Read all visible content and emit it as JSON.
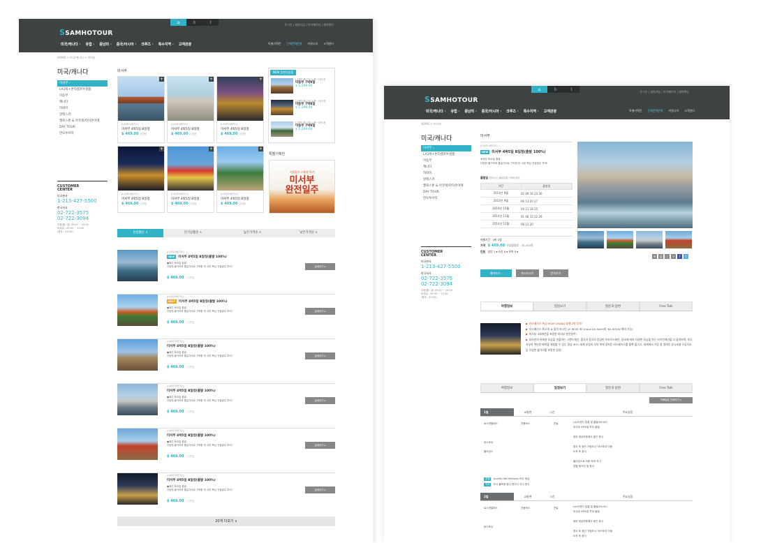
{
  "header": {
    "brand": "SAMHOTOUR",
    "util": "로그인  |  회원가입  |  마이페이지  |  예약확인",
    "gnb": [
      "미국/캐나다",
      "유럽",
      "중남미",
      "중국/아시아",
      "크루즈",
      "특수지역",
      "고객관광"
    ],
    "rnav": [
      "특별기획전",
      "단체견적문의",
      "커뮤니티",
      "고객센터"
    ],
    "rnav_active": 1
  },
  "p1": {
    "crumb": "HOME > 미국/캐나다 > 미서부",
    "title": "미국/캐나다",
    "side": [
      "미서부",
      "LA1박+온리캠프투성품",
      "미동부",
      "캐나다",
      "하와이",
      "알래스카",
      "옐로스톤 & 아웃렛/라이온이에",
      "DAY TOUR",
      "한모투어지"
    ],
    "contact": {
      "title": "CUSTOMER\nCENTER",
      "hq": "미국본사",
      "hq_phone": "1-213-427-5500",
      "kr": "한국지사",
      "kr_phone1": "02-722-3575",
      "kr_phone2": "02-722-3094",
      "hours1": "주중(월~금) 09:00 ~ 16:00",
      "hours2": "토요일 : 09:00 ~ 13:00",
      "hours3": "(휴무 : 13:00)"
    },
    "section": "미서부",
    "cards": [
      {
        "sub": "[LA/라스베가스]",
        "name": "미서부 4박5일 B일정",
        "price": "$ 469.00",
        "unit": "/1인당"
      },
      {
        "sub": "[LA/라스베가스]",
        "name": "미서부 4박5일 B일정",
        "price": "$ 469.00",
        "unit": "/1인당"
      },
      {
        "sub": "[LA/라스베가스]",
        "name": "미서부 4박5일 B일정",
        "price": "$ 469.00",
        "unit": "/1인당"
      },
      {
        "sub": "[LA/라스베가스]",
        "name": "미서부 4박5일 B일정",
        "price": "$ 469.00",
        "unit": "/1인당"
      },
      {
        "sub": "[LA/라스베가스]",
        "name": "미서부 4박5일 B일정",
        "price": "$ 469.00",
        "unit": "/1인당"
      },
      {
        "sub": "[LA/라스베가스]",
        "name": "미서부 4박5일 B일정",
        "price": "$ 469.00",
        "unit": "/1인당"
      }
    ],
    "new_badge": "NEW 추천신상품",
    "new_items": [
      {
        "sub": "[그랜드캐니언] 뉴욕~1만1천",
        "name": "미동부 7박8일",
        "price": "$ 1,299.00"
      },
      {
        "sub": "[그랜드캐니언] 뉴욕~1만1천",
        "name": "미동부 7박8일",
        "price": "$ 1,299.00"
      },
      {
        "sub": "[그랜드캐니언] 뉴욕~1만1천",
        "name": "미동부 7박8일",
        "price": "$ 1,299.00"
      }
    ],
    "promo_title": "특별기획전",
    "promo_small": "가을맞이 스페셜 특가",
    "promo_big": "미서부\n완전일주",
    "sorts": [
      "신상품순",
      "인기상품순",
      "높은가격순",
      "낮은가격순"
    ],
    "rows": [
      {
        "sub": "[LA/라스베가스]",
        "badge": "NEW",
        "badge_color": "#31b2c7",
        "title": "미서부 4박5일 B일정(출발 100%)",
        "d1": "●매주 토요일 출발",
        "d2": "다양한 볼거리와 즐길거리로 가득한 미 서부 핵심 관광일주 투어!",
        "price": "$ 469.00",
        "unit": "/1인당",
        "btn": "상세보기 ▸"
      },
      {
        "sub": "[LA/라스베가스]",
        "badge": "BEST",
        "badge_color": "#f0a030",
        "title": "미서부 4박5일 B일정(출발 100%)",
        "d1": "●매주 토요일 출발",
        "d2": "다양한 볼거리와 즐길거리로 가득한 미 서부 핵심 관광일주 투어!",
        "price": "$ 469.00",
        "unit": "/1인당",
        "btn": "상세보기 ▸"
      },
      {
        "sub": "[LA/라스베가스]",
        "badge": "",
        "badge_color": "",
        "title": "미서부 4박5일 B일정(출발 100%)",
        "d1": "●매주 토요일 출발",
        "d2": "다양한 볼거리와 즐길거리로 가득한 미 서부 핵심 관광일주 투어!",
        "price": "$ 469.00",
        "unit": "/1인당",
        "btn": "상세보기 ▸"
      },
      {
        "sub": "[LA/라스베가스]",
        "badge": "",
        "badge_color": "",
        "title": "미서부 4박5일 B일정(출발 100%)",
        "d1": "●매주 토요일 출발",
        "d2": "다양한 볼거리와 즐길거리로 가득한 미 서부 핵심 관광일주 투어!",
        "price": "$ 469.00",
        "unit": "/1인당",
        "btn": "상세보기 ▸"
      },
      {
        "sub": "[LA/라스베가스]",
        "badge": "",
        "badge_color": "",
        "title": "미서부 4박5일 B일정(출발 100%)",
        "d1": "●매주 토요일 출발",
        "d2": "다양한 볼거리와 즐길거리로 가득한 미 서부 핵심 관광일주 투어!",
        "price": "$ 469.00",
        "unit": "/1인당",
        "btn": "상세보기 ▸"
      },
      {
        "sub": "[LA/라스베가스]",
        "badge": "",
        "badge_color": "",
        "title": "미서부 4박5일 B일정(출발 100%)",
        "d1": "●매주 토요일 출발",
        "d2": "다양한 볼거리와 즐길거리로 가득한 미 서부 핵심 관광일주 투어!",
        "price": "$ 469.00",
        "unit": "/1인당",
        "btn": "상세보기 ▸"
      }
    ],
    "more": "20개 더보기 ∨"
  },
  "p2": {
    "crumb": "HOME > 미서부",
    "section": "미서부",
    "sub": "[LA/라스베가스]",
    "badge": "NEW",
    "title": "미서부 4박5일 B일정(출발 100%)",
    "d1": "★매주 토요일 출발",
    "d2": "다양한 볼거리와 즐길거리로 가득한 미 서부 핵심 관광일주 투어!",
    "dep_label": "출발일",
    "dep_hint": "원하시는 출발일을 선택하세요",
    "tab_head": [
      "기간",
      "출발일"
    ],
    "dates": [
      [
        "2014년 9월",
        "02  09  16  23  30"
      ],
      [
        "2014년 9월",
        "06  13  20  27"
      ],
      [
        "2014년 10월",
        "04  11  18  25"
      ],
      [
        "2014년 11월",
        "01  08  15  22  29"
      ],
      [
        "2014년 12월",
        "06  13  20"
      ]
    ],
    "period_label": "여행기간",
    "period": "4박 5일",
    "price_label": "가격",
    "price": "$ 469.00",
    "price_extra": "유류할증료 : 30,000원",
    "people_label": "인원",
    "people": "성인  1  ▾    소인  0  ▾    유아  0  ▾",
    "btn1": "예약하기 ›",
    "btn2": "위시리스트",
    "btn3": "문의하기",
    "tabs": [
      "여행정보",
      "일정보기",
      "질문과 답변",
      "Free Talk"
    ],
    "info": [
      {
        "t": "라스베가스 특급 MGM GRAND 호텔 2박 투숙!"
      },
      {
        "t": "라스베가스 최고의 쇼 중의 하나인 LE REVE 와 Cirque Du Soleil의 'KA SHOW 예약 가능!"
      },
      {
        "t": "미서부 3대캐년을 포함한 미서부 완전일주!"
      },
      {
        "t": "대자연의 위대한 모습을 연출하는 그랜드캐년, 협곡과 협곡의 장엄한 브라이스캐년, 날씨에 따라 다양한 모습을 하는 자이언캐년을 다 돌아보며, 미국 서부의 색다른 매력을 체험할 수 있는 환상 코스! 세계 유일의 사막 위에 꽃피운 라스베가스를 흠뻑 즐기고, 세계에서 가장 잘 알려진 유니버셜 스튜디오 등 다양한 볼거리를 포함한 일정!"
      }
    ],
    "print": "여행일정 인쇄하기 ∨",
    "day_head": [
      "교통편",
      "시간",
      "주요일정"
    ],
    "day1": {
      "d": "1일",
      "city": [
        "로스앤젤레스",
        "바스토우",
        "윌리엄스"
      ],
      "trans": "전용버스",
      "time": "전일",
      "sched": [
        "LA/오렌지 집결 및 출발(08:00)",
        "미서부 4박5일 투어 출발",
        "",
        "중부 한남마켓에서 중간 휴식",
        "",
        "휴식 후 중간 거점도시 '바스토우'이동",
        "도착 후 중식",
        "",
        "윌리엄스로 이동 하여 석식",
        "호텔 체크인 및 휴식"
      ]
    },
    "hotel": {
      "b": "호텔",
      "name": "Quality INN Williams 또는 동급",
      "meal_b": "식사",
      "meals": "조식 불포함    중식 현지식    석식 한식"
    },
    "day2": {
      "d": "2일",
      "city": [
        "로스앤젤레스",
        "바스토우"
      ],
      "trans": "전용버스",
      "time": "전일",
      "sched": [
        "LA/오렌지 집결 및 출발(08:00)",
        "미서부 4박5일 투어 출발",
        "",
        "중부 한남마켓에서 중간 휴식",
        "",
        "휴식 후 중간 거점도시 '바스토우'이동",
        "도착 후 중식"
      ]
    }
  }
}
